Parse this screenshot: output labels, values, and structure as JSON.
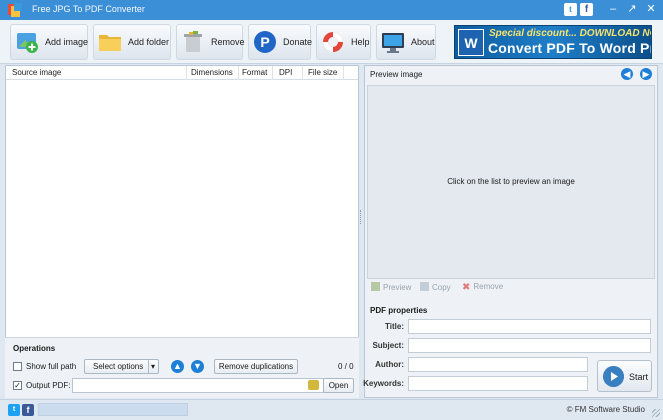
{
  "window": {
    "title": "Free JPG To PDF Converter",
    "controls": {
      "minimize": "–",
      "maximize": "↗",
      "close": "✕"
    },
    "social": {
      "twitter": "t",
      "facebook": "f"
    }
  },
  "toolbar": {
    "add_image": "Add image",
    "add_folder": "Add folder",
    "remove": "Remove",
    "donate": "Donate",
    "help": "Help",
    "about": "About"
  },
  "promo": {
    "word_glyph": "W",
    "line1": "Special discount... DOWNLOAD NOW!",
    "line2": "Convert PDF To Word Pro"
  },
  "source_table": {
    "columns": [
      "Source image",
      "Dimensions",
      "Format",
      "DPI",
      "File size"
    ],
    "rows": []
  },
  "operations": {
    "title": "Operations",
    "show_full_path": {
      "label": "Show full path",
      "checked": false
    },
    "select_options": "Select options",
    "remove_duplications": "Remove duplications",
    "count": "0 / 0",
    "output_pdf": {
      "label": "Output PDF:",
      "checked": true,
      "value": ""
    },
    "open": "Open"
  },
  "preview": {
    "title": "Preview image",
    "message": "Click on the list to preview an image",
    "actions": {
      "preview": "Preview",
      "copy": "Copy",
      "remove": "Remove"
    }
  },
  "pdf_properties": {
    "title": "PDF properties",
    "fields": [
      {
        "label": "Title:",
        "value": ""
      },
      {
        "label": "Subject:",
        "value": ""
      },
      {
        "label": "Author:",
        "value": ""
      },
      {
        "label": "Keywords:",
        "value": ""
      }
    ],
    "start": "Start"
  },
  "statusbar": {
    "progress": 0,
    "copyright": "© FM Software Studio"
  },
  "colors": {
    "titlebar": "#3b8fd6",
    "accent_blue": "#1e7fd6",
    "panel_bg": "#eef2f6"
  }
}
